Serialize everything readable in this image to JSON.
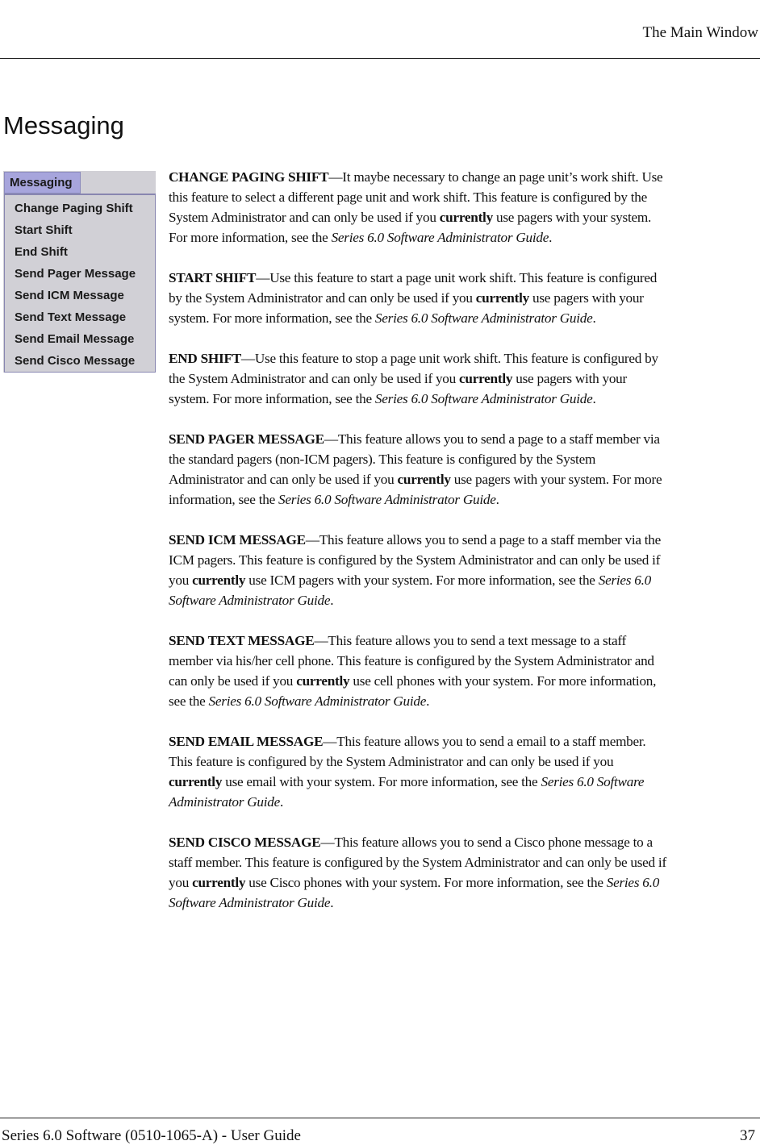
{
  "header": {
    "running_title": "The Main Window"
  },
  "section": {
    "title": "Messaging"
  },
  "menu": {
    "title": "Messaging",
    "items": [
      {
        "label": "Change Paging Shift"
      },
      {
        "label": "Start Shift"
      },
      {
        "label": "End Shift"
      },
      {
        "label": "Send Pager Message"
      },
      {
        "label": "Send ICM Message"
      },
      {
        "label": "Send Text Message"
      },
      {
        "label": "Send Email Message"
      },
      {
        "label": "Send Cisco Message"
      }
    ]
  },
  "features": [
    {
      "term": "CHANGE PAGING SHIFT",
      "dash": "—",
      "text_before": "It maybe necessary to change an page unit’s work shift. Use this feature to select a different page unit and work shift. This feature is configured by the System Administrator and can only be used if you ",
      "emphasis": "currently",
      "text_after": " use pagers with your system. For more information, see the ",
      "reference": "Series 6.0 Software Administrator Guide",
      "end": "."
    },
    {
      "term": "START SHIFT",
      "dash": "—",
      "text_before": "Use this feature to start a page unit work shift. This feature is configured by the System Administrator and can only be used if you ",
      "emphasis": "currently",
      "text_after": " use pagers with your system. For more information, see the ",
      "reference": "Series 6.0 Software Administrator Guide",
      "end": "."
    },
    {
      "term": "END SHIFT",
      "dash": "—",
      "text_before": "Use this feature to stop a page unit work shift. This feature is configured by the System Administrator and can only be used if you ",
      "emphasis": "currently",
      "text_after": " use pagers with your system. For more information, see the ",
      "reference": "Series 6.0 Software Administrator Guide",
      "end": "."
    },
    {
      "term": "SEND PAGER MESSAGE",
      "dash": "—",
      "text_before": "This feature allows you to send a page to a staff member via the standard pagers (non-ICM pagers). This feature is configured by the System Administrator and can only be used if you ",
      "emphasis": "currently",
      "text_after": " use pagers with your system. For more information, see the ",
      "reference": "Series 6.0 Software Administrator Guide",
      "end": "."
    },
    {
      "term": "SEND ICM MESSAGE",
      "dash": "—",
      "text_before": "This feature allows you to send a page to a staff member via the ICM pagers. This feature is configured by the System Administrator and can only be used if you ",
      "emphasis": "currently",
      "text_after": " use ICM pagers with your system. For more information, see the ",
      "reference": "Series 6.0 Software Administrator Guide",
      "end": "."
    },
    {
      "term": "SEND TEXT MESSAGE",
      "dash": "—",
      "text_before": "This feature allows you to send a text message to a staff member via his/her cell phone. This feature is configured by the System Administrator and can only be used if you ",
      "emphasis": "currently",
      "text_after": " use cell phones with your system. For more information, see the ",
      "reference": "Series 6.0 Software Administrator Guide",
      "end": "."
    },
    {
      "term": "SEND EMAIL MESSAGE",
      "dash": "—",
      "text_before": "This feature allows you to send a email to a staff member. This feature is configured by the System Administrator and can only be used if you ",
      "emphasis": "currently",
      "text_after": " use email with your system. For more information, see the ",
      "reference": "Series 6.0 Software Administrator Guide",
      "end": "."
    },
    {
      "term": "SEND CISCO MESSAGE",
      "dash": "—",
      "text_before": "This feature allows you to send a Cisco phone message to a staff member. This feature is configured by the System Administrator and can only be used if you ",
      "emphasis": "currently",
      "text_after": " use Cisco phones with your system. For more information, see the ",
      "reference": "Series 6.0 Software Administrator Guide",
      "end": "."
    }
  ],
  "footer": {
    "document_title": "Series 6.0 Software (0510-1065-A) - User Guide",
    "page_number": "37"
  },
  "colors": {
    "menu_background": "#d1d0d6",
    "menu_tab_selected": "#a7a5dc",
    "menu_border": "#8886b0"
  }
}
